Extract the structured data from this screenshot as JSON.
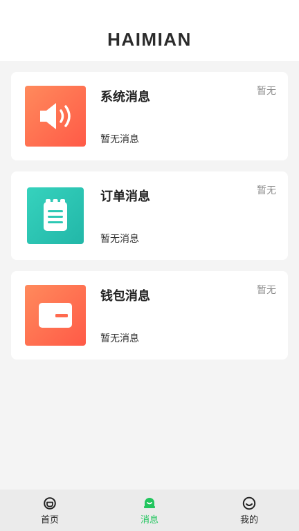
{
  "app": {
    "brand": "HAIMIAN"
  },
  "messages": [
    {
      "title": "系统消息",
      "preview": "暂无消息",
      "time": "暂无",
      "icon": "speaker-icon",
      "color": "#ff7a4f"
    },
    {
      "title": "订单消息",
      "preview": "暂无消息",
      "time": "暂无",
      "icon": "notepad-icon",
      "color": "#2cc8b4"
    },
    {
      "title": "钱包消息",
      "preview": "暂无消息",
      "time": "暂无",
      "icon": "wallet-icon",
      "color": "#ff6f4f"
    }
  ],
  "tabbar": {
    "active_color": "#22c55e",
    "items": [
      {
        "label": "首页",
        "icon": "home-icon"
      },
      {
        "label": "消息",
        "icon": "message-bell-icon"
      },
      {
        "label": "我的",
        "icon": "profile-icon"
      }
    ]
  }
}
